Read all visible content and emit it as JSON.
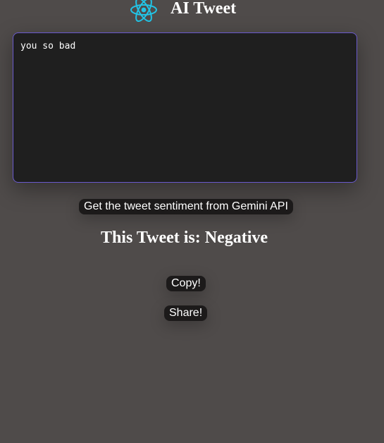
{
  "header": {
    "logo_icon": "react-atom-icon",
    "title": "AI Tweet"
  },
  "tweet_input": {
    "value": "you so bad"
  },
  "actions": {
    "sentiment_button_label": "Get the tweet sentiment from Gemini API",
    "copy_button_label": "Copy!",
    "share_button_label": "Share!"
  },
  "result": {
    "prefix": "This Tweet is: ",
    "sentiment": "Negative"
  },
  "colors": {
    "background": "#4f4b4a",
    "textarea_bg": "#1f1f1f",
    "textarea_border": "#6a5acd",
    "button_bg": "#1c1a1a",
    "logo": "#22c4e6"
  }
}
